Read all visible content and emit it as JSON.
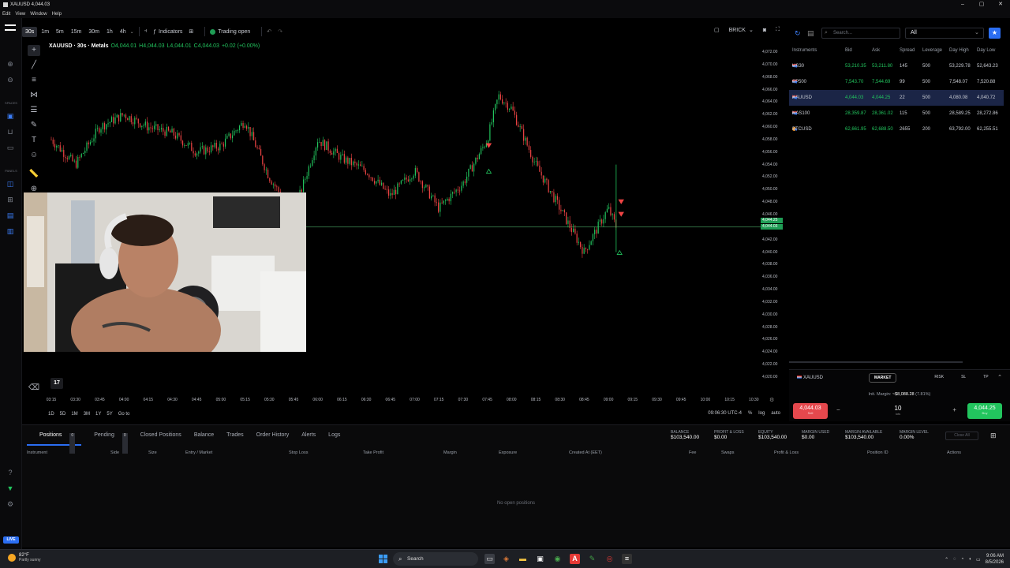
{
  "window": {
    "title": "XAUUSD 4,044.03",
    "menu": [
      "Edit",
      "View",
      "Window",
      "Help"
    ],
    "controls": [
      "–",
      "▢",
      "✕"
    ]
  },
  "rail": {
    "labels": [
      "SPACES",
      "PANELS"
    ],
    "live": "LIVE"
  },
  "toolbar": {
    "timeframes": [
      "30s",
      "1m",
      "5m",
      "15m",
      "30m",
      "1h",
      "4h"
    ],
    "active_timeframe": "30s",
    "indicators_label": "Indicators",
    "trading_status": "Trading open",
    "chart_type": "BRICK"
  },
  "legend": {
    "symbol": "XAUUSD · 30s · Metals",
    "o": "O4,044.01",
    "h": "H4,044.03",
    "l": "L4,044.01",
    "c": "C4,044.03",
    "change": "+0.02 (+0.00%)"
  },
  "chart_data": {
    "type": "candlestick",
    "symbol": "XAUUSD",
    "interval": "30s",
    "ylim": [
      4020,
      4072
    ],
    "y_ticks": [
      "4,072.00",
      "4,070.00",
      "4,068.00",
      "4,066.00",
      "4,064.00",
      "4,062.00",
      "4,060.00",
      "4,058.00",
      "4,056.00",
      "4,054.00",
      "4,052.00",
      "4,050.00",
      "4,048.00",
      "4,046.00",
      "4,044.00",
      "4,042.00",
      "4,040.00",
      "4,038.00",
      "4,036.00",
      "4,034.00",
      "4,032.00",
      "4,030.00",
      "4,028.00",
      "4,026.00",
      "4,024.00",
      "4,022.00",
      "4,020.00"
    ],
    "x_ticks": [
      "03:15",
      "03:30",
      "03:45",
      "04:00",
      "04:15",
      "04:30",
      "04:45",
      "05:00",
      "05:15",
      "05:30",
      "05:45",
      "06:00",
      "06:15",
      "06:30",
      "06:45",
      "07:00",
      "07:15",
      "07:30",
      "07:45",
      "08:00",
      "08:15",
      "08:30",
      "08:45",
      "09:00",
      "09:15",
      "09:30",
      "09:45",
      "10:00",
      "10:15",
      "10:30"
    ],
    "price_path": {
      "times": [
        "03:15",
        "03:30",
        "03:45",
        "04:00",
        "04:15",
        "04:30",
        "04:45",
        "05:00",
        "05:15",
        "05:30",
        "05:45",
        "06:00",
        "06:15",
        "06:30",
        "06:45",
        "07:00",
        "07:15",
        "07:30",
        "07:45",
        "07:52",
        "08:00",
        "08:15",
        "08:30",
        "08:45",
        "09:00",
        "09:05"
      ],
      "values": [
        4058,
        4054,
        4060,
        4062,
        4060,
        4059,
        4056,
        4057,
        4061,
        4052,
        4046,
        4058,
        4055,
        4053,
        4049,
        4053,
        4047,
        4051,
        4058,
        4065,
        4063,
        4054,
        4047,
        4040,
        4047,
        4044
      ]
    },
    "current_price_tags": [
      "4,044.25",
      "4,044.03"
    ],
    "current_price": 4044.03,
    "time_readout": "09:06:30 UTC-4"
  },
  "range_bar": {
    "ranges": [
      "1D",
      "5D",
      "1M",
      "3M",
      "1Y",
      "5Y"
    ],
    "goto": "Go to",
    "time": "09:06:30 UTC-4",
    "opts": [
      "%",
      "log",
      "auto"
    ]
  },
  "instruments": {
    "search_placeholder": "Search...",
    "filter": "All",
    "columns": [
      "Instruments",
      "Bid",
      "Ask",
      "Spread",
      "Leverage",
      "Day High",
      "Day Low"
    ],
    "rows": [
      {
        "name": "US30",
        "bid": "53,210.35",
        "ask": "53,211.80",
        "spread": "145",
        "leverage": "500",
        "high": "53,229.78",
        "low": "52,643.23",
        "selected": false
      },
      {
        "name": "SP500",
        "bid": "7,543.70",
        "ask": "7,544.69",
        "spread": "99",
        "leverage": "500",
        "high": "7,548.07",
        "low": "7,520.88",
        "selected": false
      },
      {
        "name": "XAUUSD",
        "bid": "4,044.03",
        "ask": "4,044.25",
        "spread": "22",
        "leverage": "500",
        "high": "4,080.08",
        "low": "4,040.72",
        "selected": true
      },
      {
        "name": "NAS100",
        "bid": "28,359.87",
        "ask": "28,361.02",
        "spread": "115",
        "leverage": "500",
        "high": "28,589.25",
        "low": "28,272.86",
        "selected": false
      },
      {
        "name": "BTCUSD",
        "bid": "62,661.95",
        "ask": "62,688.50",
        "spread": "2655",
        "leverage": "200",
        "high": "63,792.00",
        "low": "62,255.51",
        "selected": false
      }
    ]
  },
  "order": {
    "symbol": "XAUUSD",
    "tabs": [
      "MARKET",
      "RISK",
      "SL",
      "TP"
    ],
    "margin_label": "Init. Margin:",
    "margin_value": "~$8,088.28",
    "margin_pct": "(7.81%)",
    "sell_price": "4,044.03",
    "sell_label": "Sell",
    "buy_price": "4,044.25",
    "buy_label": "Buy",
    "lots": "10",
    "lots_label": "lots"
  },
  "bottom": {
    "tabs": [
      {
        "label": "Positions",
        "count": "0"
      },
      {
        "label": "Pending",
        "count": "0"
      },
      {
        "label": "Closed Positions"
      },
      {
        "label": "Balance"
      },
      {
        "label": "Trades"
      },
      {
        "label": "Order History"
      },
      {
        "label": "Alerts"
      },
      {
        "label": "Logs"
      }
    ],
    "stats": [
      {
        "label": "BALANCE",
        "value": "$103,540.00"
      },
      {
        "label": "PROFIT & LOSS",
        "value": "$0.00"
      },
      {
        "label": "EQUITY",
        "value": "$103,540.00"
      },
      {
        "label": "MARGIN USED",
        "value": "$0.00"
      },
      {
        "label": "MARGIN AVAILABLE",
        "value": "$103,540.00"
      },
      {
        "label": "MARGIN LEVEL",
        "value": "0.00%"
      }
    ],
    "close_all": "Close All",
    "columns": [
      "Instrument",
      "Side",
      "Size",
      "Entry / Market",
      "Stop Loss",
      "Take Profit",
      "Margin",
      "Exposure",
      "Created At (EET)",
      "Fee",
      "Swaps",
      "Profit & Loss",
      "Position ID",
      "Actions"
    ],
    "empty": "No open positions"
  },
  "taskbar": {
    "temp": "82°F",
    "weather": "Partly sunny",
    "search": "Search",
    "time": "9:06 AM",
    "date": "8/5/2026"
  }
}
